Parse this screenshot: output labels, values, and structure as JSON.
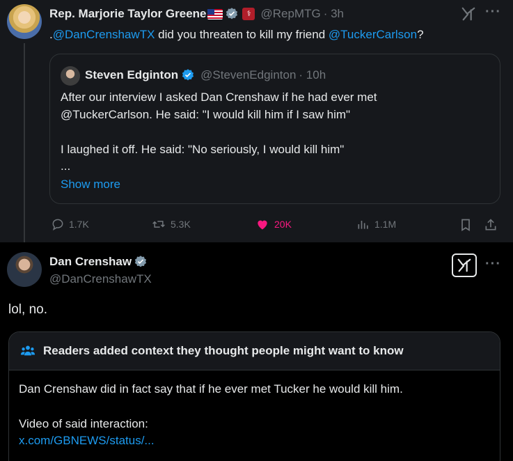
{
  "post1": {
    "author_name": "Rep. Marjorie Taylor Greene",
    "handle": "@RepMTG",
    "time": "· 3h",
    "text_prefix": ".",
    "mention1": "@DanCrenshawTX",
    "text_middle": " did you threaten to kill my friend ",
    "mention2": "@TuckerCarlson",
    "text_suffix": "?",
    "quote": {
      "author_name": "Steven Edginton",
      "handle": "@StevenEdginton",
      "time": "· 10h",
      "line1": "After our interview I asked Dan Crenshaw if he had ever met",
      "line2": "@TuckerCarlson. He said: \"I would kill him if I saw him\"",
      "line3": "I laughed it off. He said: \"No seriously, I would kill him\"",
      "line4": "...",
      "show_more": "Show more"
    },
    "actions": {
      "replies": "1.7K",
      "reposts": "5.3K",
      "likes": "20K",
      "views": "1.1M"
    },
    "colors": {
      "like": "#f91880",
      "link": "#1d9bf0",
      "verified_blue": "#1d9bf0"
    }
  },
  "post2": {
    "author_name": "Dan Crenshaw",
    "handle": "@DanCrenshawTX",
    "text": "lol, no.",
    "community_note": {
      "title": "Readers added context they thought people might want to know",
      "body1": "Dan Crenshaw did in fact say that if he ever met Tucker he would kill him.",
      "body2": "Video of said interaction:",
      "link": "x.com/GBNEWS/status/..."
    }
  }
}
